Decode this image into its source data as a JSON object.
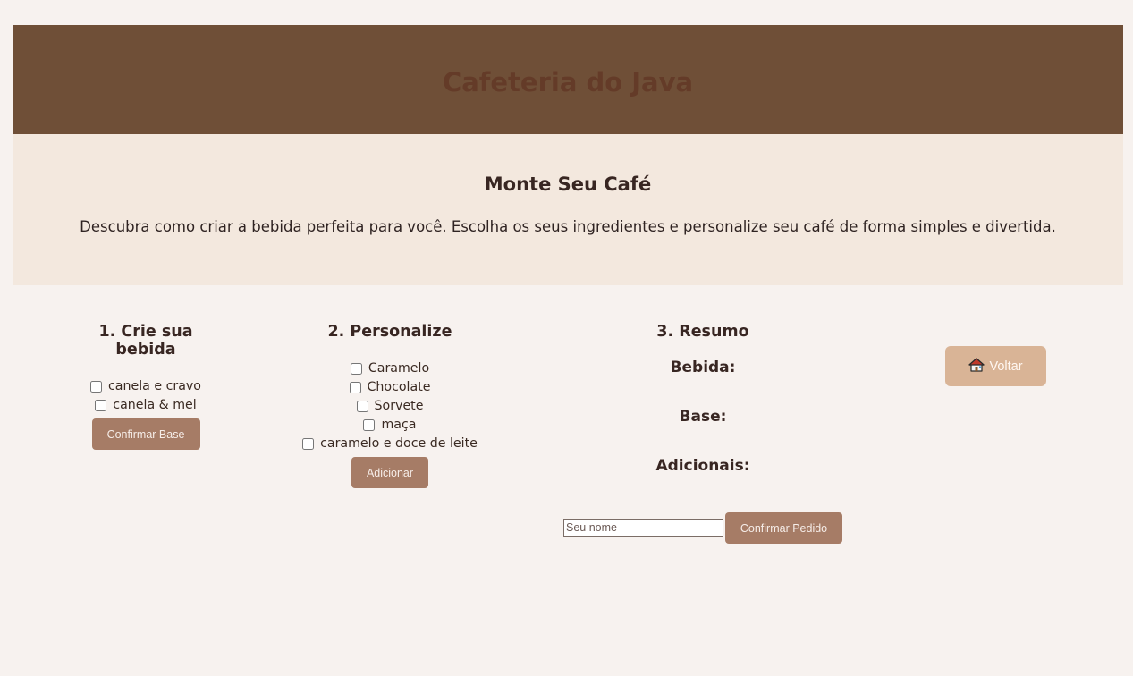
{
  "header": {
    "title": "Cafeteria do Java"
  },
  "hero": {
    "title": "Monte Seu Café",
    "description": "Descubra como criar a bebida perfeita para você. Escolha os seus ingredientes e personalize seu café de forma simples e divertida."
  },
  "step1": {
    "title": "1. Crie sua bebida",
    "options": [
      "canela e cravo",
      "canela & mel"
    ],
    "button": "Confirmar Base"
  },
  "step2": {
    "title": "2. Personalize",
    "options": [
      "Caramelo",
      "Chocolate",
      "Sorvete",
      "maça",
      "caramelo e doce de leite"
    ],
    "button": "Adicionar"
  },
  "step3": {
    "title": "3. Resumo",
    "labels": {
      "drink": "Bebida:",
      "base": "Base:",
      "extras": "Adicionais:"
    },
    "name_placeholder": "Seu nome",
    "confirm_button": "Confirmar Pedido"
  },
  "nav": {
    "back_label": "Voltar",
    "back_icon": "house-icon"
  },
  "colors": {
    "header_bg": "#6f4f37",
    "header_title": "#643b28",
    "hero_bg": "#f3e8de",
    "page_bg": "#f7f2ef",
    "button_bg": "#a67c66",
    "back_button_bg": "#d9b496"
  }
}
